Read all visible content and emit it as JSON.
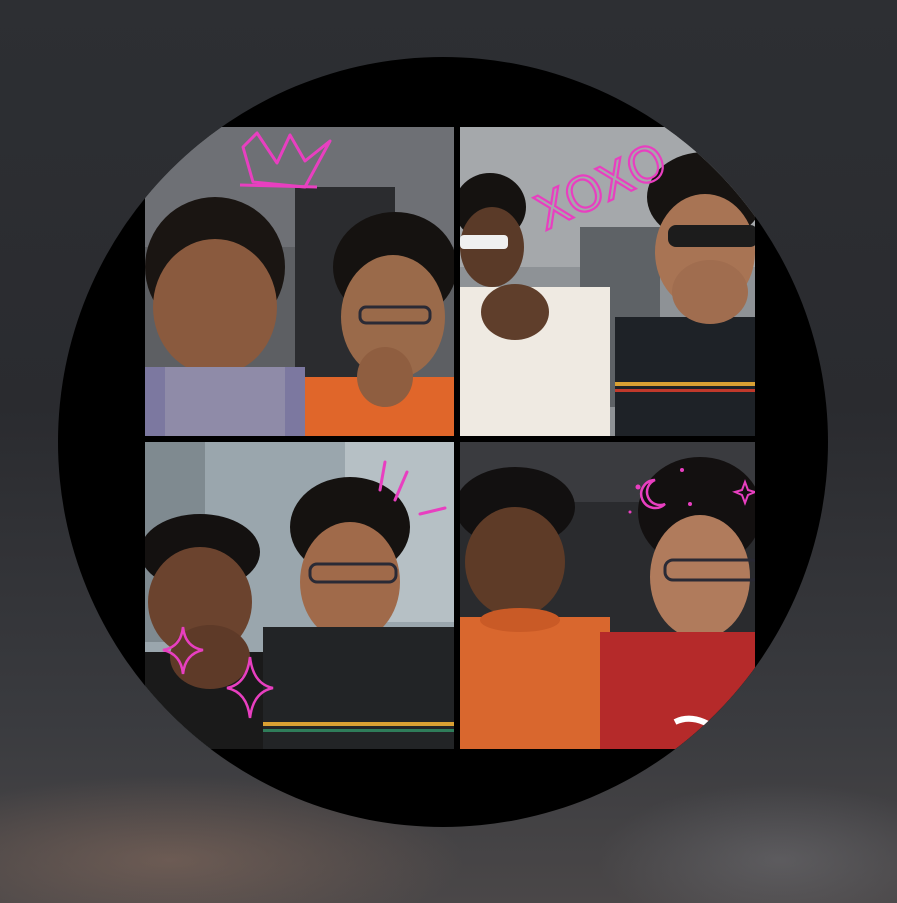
{
  "viewer": {
    "background_color": "#2c2d31",
    "avatar_shape": "circle"
  },
  "collage": {
    "layout": "2x2 grid",
    "doodle_color": "#e83fc0",
    "panels": [
      {
        "position": "top-left",
        "doodle": "crown-icon"
      },
      {
        "position": "top-right",
        "doodle_text": "XOXO"
      },
      {
        "position": "bottom-left",
        "doodle": "sparkle-icon"
      },
      {
        "position": "bottom-right",
        "doodle": "moon-icon"
      }
    ]
  }
}
